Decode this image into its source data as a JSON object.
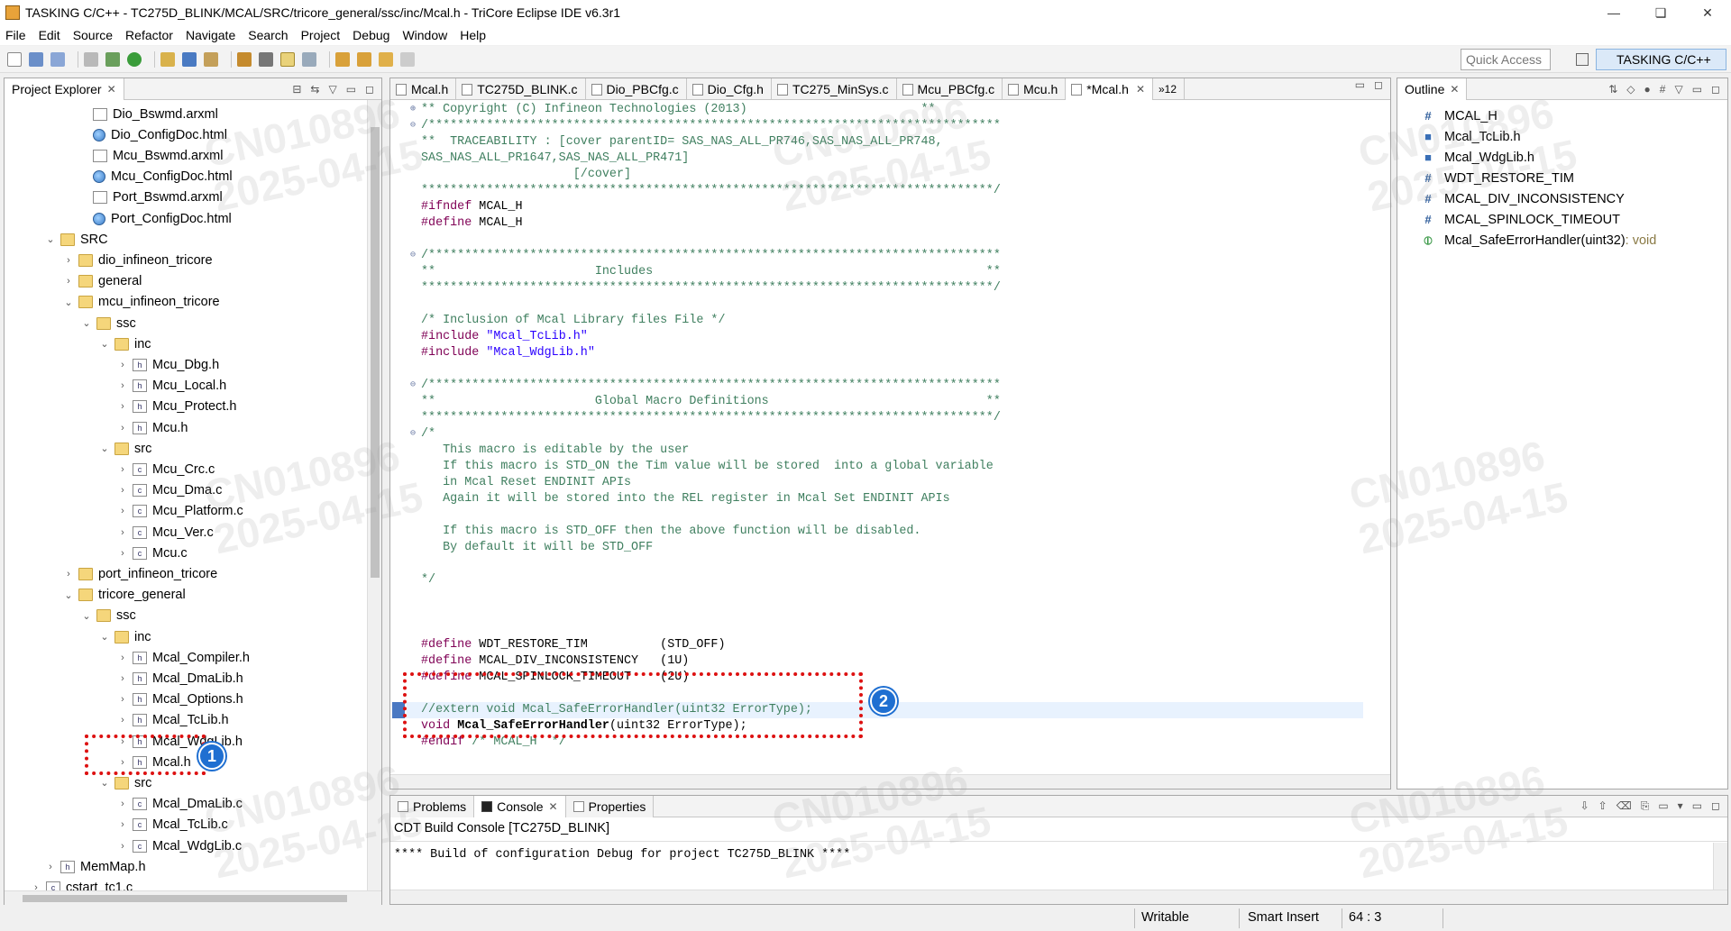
{
  "window": {
    "title": "TASKING C/C++ - TC275D_BLINK/MCAL/SRC/tricore_general/ssc/inc/Mcal.h - TriCore Eclipse IDE v6.3r1",
    "controls": [
      "—",
      "❏",
      "✕"
    ]
  },
  "menu": [
    "File",
    "Edit",
    "Source",
    "Refactor",
    "Navigate",
    "Search",
    "Project",
    "Debug",
    "Window",
    "Help"
  ],
  "toolbar": {
    "quick_access_placeholder": "Quick Access",
    "perspective_label": "TASKING C/C++"
  },
  "explorer": {
    "title": "Project Explorer",
    "items": [
      {
        "label": "Dio_Bswmd.arxml",
        "icon": "xml-file-icon",
        "twisty": ""
      },
      {
        "label": "Dio_ConfigDoc.html",
        "icon": "html-file-icon",
        "twisty": ""
      },
      {
        "label": "Mcu_Bswmd.arxml",
        "icon": "xml-file-icon",
        "twisty": ""
      },
      {
        "label": "Mcu_ConfigDoc.html",
        "icon": "html-file-icon",
        "twisty": ""
      },
      {
        "label": "Port_Bswmd.arxml",
        "icon": "xml-file-icon",
        "twisty": ""
      },
      {
        "label": "Port_ConfigDoc.html",
        "icon": "html-file-icon",
        "twisty": ""
      },
      {
        "label": "SRC",
        "icon": "folder-icon",
        "twisty": "⌄"
      },
      {
        "label": "dio_infineon_tricore",
        "icon": "folder-icon",
        "twisty": "›"
      },
      {
        "label": "general",
        "icon": "folder-icon",
        "twisty": "›"
      },
      {
        "label": "mcu_infineon_tricore",
        "icon": "folder-icon",
        "twisty": "⌄"
      },
      {
        "label": "ssc",
        "icon": "folder-icon",
        "twisty": "⌄"
      },
      {
        "label": "inc",
        "icon": "folder-icon",
        "twisty": "⌄"
      },
      {
        "label": "Mcu_Dbg.h",
        "icon": "header-file-icon",
        "twisty": "›"
      },
      {
        "label": "Mcu_Local.h",
        "icon": "header-file-icon",
        "twisty": "›"
      },
      {
        "label": "Mcu_Protect.h",
        "icon": "header-file-icon",
        "twisty": "›"
      },
      {
        "label": "Mcu.h",
        "icon": "header-file-icon",
        "twisty": "›"
      },
      {
        "label": "src",
        "icon": "folder-icon",
        "twisty": "⌄"
      },
      {
        "label": "Mcu_Crc.c",
        "icon": "c-file-icon",
        "twisty": "›"
      },
      {
        "label": "Mcu_Dma.c",
        "icon": "c-file-icon",
        "twisty": "›"
      },
      {
        "label": "Mcu_Platform.c",
        "icon": "c-file-icon",
        "twisty": "›"
      },
      {
        "label": "Mcu_Ver.c",
        "icon": "c-file-icon",
        "twisty": "›"
      },
      {
        "label": "Mcu.c",
        "icon": "c-file-icon",
        "twisty": "›"
      },
      {
        "label": "port_infineon_tricore",
        "icon": "folder-icon",
        "twisty": "›"
      },
      {
        "label": "tricore_general",
        "icon": "folder-icon",
        "twisty": "⌄"
      },
      {
        "label": "ssc",
        "icon": "folder-icon",
        "twisty": "⌄"
      },
      {
        "label": "inc",
        "icon": "folder-icon",
        "twisty": "⌄"
      },
      {
        "label": "Mcal_Compiler.h",
        "icon": "header-file-icon",
        "twisty": "›"
      },
      {
        "label": "Mcal_DmaLib.h",
        "icon": "header-file-icon",
        "twisty": "›"
      },
      {
        "label": "Mcal_Options.h",
        "icon": "header-file-icon",
        "twisty": "›"
      },
      {
        "label": "Mcal_TcLib.h",
        "icon": "header-file-icon",
        "twisty": "›"
      },
      {
        "label": "Mcal_WdgLib.h",
        "icon": "header-file-icon",
        "twisty": "›"
      },
      {
        "label": "Mcal.h",
        "icon": "header-file-icon",
        "twisty": "›"
      },
      {
        "label": "src",
        "icon": "folder-icon",
        "twisty": "⌄"
      },
      {
        "label": "Mcal_DmaLib.c",
        "icon": "c-file-icon",
        "twisty": "›"
      },
      {
        "label": "Mcal_TcLib.c",
        "icon": "c-file-icon",
        "twisty": "›"
      },
      {
        "label": "Mcal_WdgLib.c",
        "icon": "c-file-icon",
        "twisty": "›"
      },
      {
        "label": "MemMap.h",
        "icon": "header-file-icon",
        "twisty": "›"
      },
      {
        "label": "cstart_tc1.c",
        "icon": "c-file-icon",
        "twisty": "›"
      }
    ]
  },
  "editor": {
    "tabs": [
      {
        "label": "Mcal.h",
        "active": false
      },
      {
        "label": "TC275D_BLINK.c",
        "active": false
      },
      {
        "label": "Dio_PBCfg.c",
        "active": false
      },
      {
        "label": "Dio_Cfg.h",
        "active": false
      },
      {
        "label": "TC275_MinSys.c",
        "active": false
      },
      {
        "label": "Mcu_PBCfg.c",
        "active": false
      },
      {
        "label": "Mcu.h",
        "active": false
      },
      {
        "label": "*Mcal.h",
        "active": true
      }
    ],
    "overflow_label": "»12",
    "lines": [
      {
        "text": "** Copyright (C) Infineon Technologies (2013)                        **",
        "cls": "cmt"
      },
      {
        "text": "/*******************************************************************************",
        "cls": "cmt"
      },
      {
        "text": "**  TRACEABILITY : [cover parentID= SAS_NAS_ALL_PR746,SAS_NAS_ALL_PR748,",
        "cls": "cmt"
      },
      {
        "text": "SAS_NAS_ALL_PR1647,SAS_NAS_ALL_PR471]",
        "cls": "cmt"
      },
      {
        "text": "                     [/cover]",
        "cls": "cmt"
      },
      {
        "text": "*******************************************************************************/",
        "cls": "cmt"
      },
      {
        "text": "#ifndef MCAL_H",
        "cls": "pp"
      },
      {
        "text": "#define MCAL_H",
        "cls": "pp"
      },
      {
        "text": "",
        "cls": ""
      },
      {
        "text": "/*******************************************************************************",
        "cls": "cmt"
      },
      {
        "text": "**                      Includes                                              **",
        "cls": "cmt"
      },
      {
        "text": "*******************************************************************************/",
        "cls": "cmt"
      },
      {
        "text": "",
        "cls": ""
      },
      {
        "text": "/* Inclusion of Mcal Library files File */",
        "cls": "cmt"
      },
      {
        "text": "#include \"Mcal_TcLib.h\"",
        "cls": "inc"
      },
      {
        "text": "#include \"Mcal_WdgLib.h\"",
        "cls": "inc"
      },
      {
        "text": "",
        "cls": ""
      },
      {
        "text": "/*******************************************************************************",
        "cls": "cmt"
      },
      {
        "text": "**                      Global Macro Definitions                              **",
        "cls": "cmt"
      },
      {
        "text": "*******************************************************************************/",
        "cls": "cmt"
      },
      {
        "text": "/*",
        "cls": "cmt"
      },
      {
        "text": "   This macro is editable by the user",
        "cls": "cmt"
      },
      {
        "text": "   If this macro is STD_ON the Tim value will be stored  into a global variable",
        "cls": "cmt"
      },
      {
        "text": "   in Mcal Reset ENDINIT APIs",
        "cls": "cmt"
      },
      {
        "text": "   Again it will be stored into the REL register in Mcal Set ENDINIT APIs",
        "cls": "cmt"
      },
      {
        "text": "",
        "cls": ""
      },
      {
        "text": "   If this macro is STD_OFF then the above function will be disabled.",
        "cls": "cmt"
      },
      {
        "text": "   By default it will be STD_OFF",
        "cls": "cmt"
      },
      {
        "text": "",
        "cls": ""
      },
      {
        "text": "*/",
        "cls": "cmt"
      },
      {
        "text": "",
        "cls": ""
      },
      {
        "text": "",
        "cls": ""
      },
      {
        "text": "",
        "cls": ""
      },
      {
        "text": "#define WDT_RESTORE_TIM          (STD_OFF)",
        "cls": "def"
      },
      {
        "text": "#define MCAL_DIV_INCONSISTENCY   (1U)",
        "cls": "def"
      },
      {
        "text": "#define MCAL_SPINLOCK_TIMEOUT    (2U)",
        "cls": "def"
      },
      {
        "text": "",
        "cls": ""
      },
      {
        "text": "//extern void Mcal_SafeErrorHandler(uint32 ErrorType);",
        "cls": "cmt"
      },
      {
        "text": "void Mcal_SafeErrorHandler(uint32 ErrorType);",
        "cls": "decl"
      },
      {
        "text": "#endif /* MCAL_H  */",
        "cls": "endif"
      }
    ]
  },
  "outline": {
    "title": "Outline",
    "items": [
      {
        "label": "MCAL_H",
        "kind": "#",
        "type": ""
      },
      {
        "label": "Mcal_TcLib.h",
        "kind": "inc",
        "type": ""
      },
      {
        "label": "Mcal_WdgLib.h",
        "kind": "inc",
        "type": ""
      },
      {
        "label": "WDT_RESTORE_TIM",
        "kind": "#",
        "type": ""
      },
      {
        "label": "MCAL_DIV_INCONSISTENCY",
        "kind": "#",
        "type": ""
      },
      {
        "label": "MCAL_SPINLOCK_TIMEOUT",
        "kind": "#",
        "type": ""
      },
      {
        "label": "Mcal_SafeErrorHandler(uint32)",
        "kind": "fn",
        "type": " : void"
      }
    ]
  },
  "bottom": {
    "tabs": [
      "Problems",
      "Console",
      "Properties"
    ],
    "console_title": "CDT Build Console [TC275D_BLINK]",
    "console_text": "**** Build of configuration Debug for project TC275D_BLINK ****"
  },
  "status": {
    "writable": "Writable",
    "insert_mode": "Smart Insert",
    "position": "64 : 3"
  },
  "annotations": {
    "badge1": "1",
    "badge2": "2"
  },
  "watermark": {
    "id": "CN010896",
    "date": "2025-04-15"
  },
  "colors": {
    "annotation_red": "#dd1111",
    "badge_blue": "#1f6fd1",
    "comment_green": "#3f7f5f",
    "keyword_purple": "#7f0055",
    "string_blue": "#2a00ff"
  }
}
